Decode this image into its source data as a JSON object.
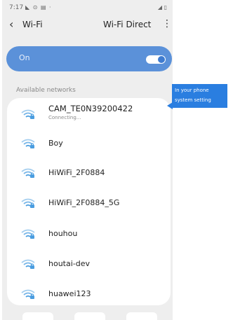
{
  "status_bar": {
    "time": "7:17",
    "left_icons": "◣ ⊙ ▤ ·",
    "right_icons": "◢ ▯"
  },
  "app_bar": {
    "back_icon": "‹",
    "title": "Wi-Fi",
    "wifi_direct": "Wi-Fi Direct",
    "more_icon": "⋮"
  },
  "toggle_bar": {
    "label": "On",
    "enabled": true
  },
  "available_label": "Available networks",
  "networks": [
    {
      "name": "CAM_TE0N39200422",
      "status": "Connecting..."
    },
    {
      "name": "Boy",
      "status": ""
    },
    {
      "name": "HiWiFi_2F0884",
      "status": ""
    },
    {
      "name": "HiWiFi_2F0884_5G",
      "status": ""
    },
    {
      "name": "houhou",
      "status": ""
    },
    {
      "name": "houtai-dev",
      "status": ""
    },
    {
      "name": "huawei123",
      "status": ""
    }
  ],
  "tooltip": {
    "line1": "In your phone",
    "line2": "system setting"
  },
  "colors": {
    "accent": "#5b91d9",
    "tooltip": "#2a7ee0",
    "wifi_icon": "#4a9de0"
  }
}
